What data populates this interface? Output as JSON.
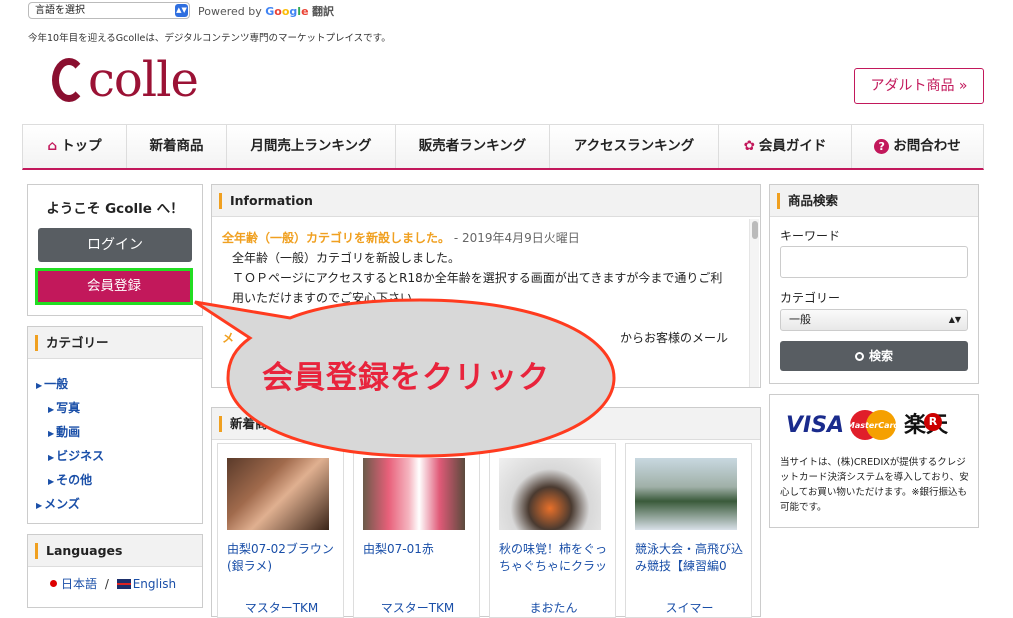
{
  "topbar": {
    "lang_select": "言語を選択",
    "powered_by": "Powered by",
    "google": [
      "G",
      "o",
      "o",
      "g",
      "l",
      "e"
    ],
    "translate": "翻訳"
  },
  "tagline": "今年10年目を迎えるGcolleは、デジタルコンテンツ専門のマーケットプレイスです。",
  "logo": {
    "text": "colle"
  },
  "adult_button": "アダルト商品 »",
  "nav": [
    {
      "label": "トップ",
      "icon": "home-icon",
      "glyph": "⌂"
    },
    {
      "label": "新着商品"
    },
    {
      "label": "月間売上ランキング"
    },
    {
      "label": "販売者ランキング"
    },
    {
      "label": "アクセスランキング"
    },
    {
      "label": "会員ガイド",
      "icon": "gift-icon",
      "glyph": "✿"
    },
    {
      "label": "お問合わせ",
      "icon": "question-icon",
      "glyph": "?"
    }
  ],
  "welcome": {
    "title": "ようこそ Gcolle へ！",
    "login": "ログイン",
    "register": "会員登録"
  },
  "category": {
    "heading": "カテゴリー",
    "items": [
      {
        "label": "一般",
        "level": 0
      },
      {
        "label": "写真",
        "level": 1
      },
      {
        "label": "動画",
        "level": 1
      },
      {
        "label": "ビジネス",
        "level": 1
      },
      {
        "label": "その他",
        "level": 1
      },
      {
        "label": "メンズ",
        "level": 0
      }
    ]
  },
  "languages": {
    "heading": "Languages",
    "japanese": "日本語",
    "separator": "/",
    "english": "English"
  },
  "info": {
    "heading": "Information",
    "entry_title": "全年齢（一般）カテゴリを新設しました。",
    "entry_date": "- 2019年4月9日火曜日",
    "line1": "全年齢（一般）カテゴリを新設しました。",
    "line2": "ＴＯＰページにアクセスするとR18か全年齢を選択する画面が出てきますが今まで通りご利",
    "line3": "用いただけますのでご安心下さい。",
    "partial_left": "メ",
    "partial_right": "からお客様のメール"
  },
  "new_products": {
    "heading": "新着商品",
    "items": [
      {
        "title": "由梨07-02ブラウン(銀ラメ)",
        "seller": "マスターTKM"
      },
      {
        "title": "由梨07-01赤",
        "seller": "マスターTKM"
      },
      {
        "title": "秋の味覚！柿をぐっちゃぐちゃにクラッ",
        "seller": "まおたん"
      },
      {
        "title": "競泳大会・高飛び込み競技【練習編0",
        "seller": "スイマー"
      }
    ]
  },
  "search": {
    "heading": "商品検索",
    "keyword_label": "キーワード",
    "keyword_value": "",
    "category_label": "カテゴリー",
    "category_value": "一般",
    "button": "検索"
  },
  "payment": {
    "visa": "VISA",
    "mastercard": "MasterCard",
    "rakuten": "楽天",
    "text": "当サイトは、(株)CREDIXが提供するクレジットカード決済システムを導入しており、安心してお買い物いただけます。※銀行振込も可能です。"
  },
  "callout": {
    "text": "会員登録をクリック"
  },
  "colors": {
    "brand": "#c2185b",
    "accent": "#f0a020",
    "link": "#1a4fa8",
    "callout_text": "#e8243c",
    "highlight": "#22dd22"
  }
}
